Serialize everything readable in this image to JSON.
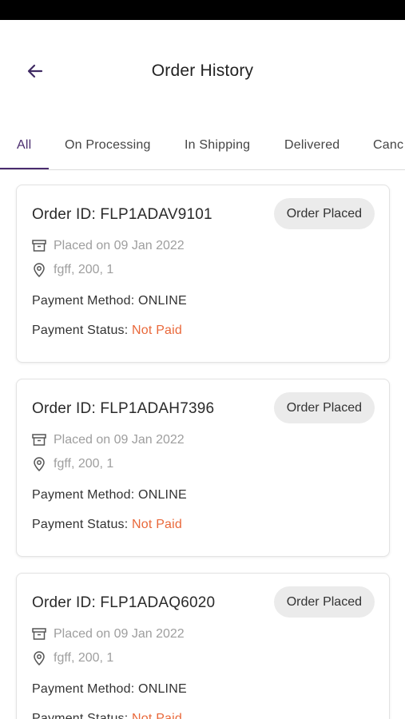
{
  "header": {
    "title": "Order History"
  },
  "tabs": [
    {
      "label": "All",
      "active": true
    },
    {
      "label": "On Processing",
      "active": false
    },
    {
      "label": "In Shipping",
      "active": false
    },
    {
      "label": "Delivered",
      "active": false
    },
    {
      "label": "Canc",
      "active": false
    }
  ],
  "colors": {
    "accent": "#4a2c6e",
    "not_paid": "#e9683a",
    "badge_bg": "#ebebeb"
  },
  "orders": [
    {
      "order_id": "Order ID: FLP1ADAV9101",
      "status": "Order Placed",
      "placed_on": "Placed on 09 Jan 2022",
      "address": "fgff, 200, 1",
      "payment_method_label": "Payment Method: ",
      "payment_method": "ONLINE",
      "payment_status_label": "Payment Status: ",
      "payment_status": "Not Paid"
    },
    {
      "order_id": "Order ID: FLP1ADAH7396",
      "status": "Order Placed",
      "placed_on": "Placed on 09 Jan 2022",
      "address": "fgff, 200, 1",
      "payment_method_label": "Payment Method: ",
      "payment_method": "ONLINE",
      "payment_status_label": "Payment Status: ",
      "payment_status": "Not Paid"
    },
    {
      "order_id": "Order ID: FLP1ADAQ6020",
      "status": "Order Placed",
      "placed_on": "Placed on 09 Jan 2022",
      "address": "fgff, 200, 1",
      "payment_method_label": "Payment Method: ",
      "payment_method": "ONLINE",
      "payment_status_label": "Payment Status: ",
      "payment_status": "Not Paid"
    }
  ]
}
